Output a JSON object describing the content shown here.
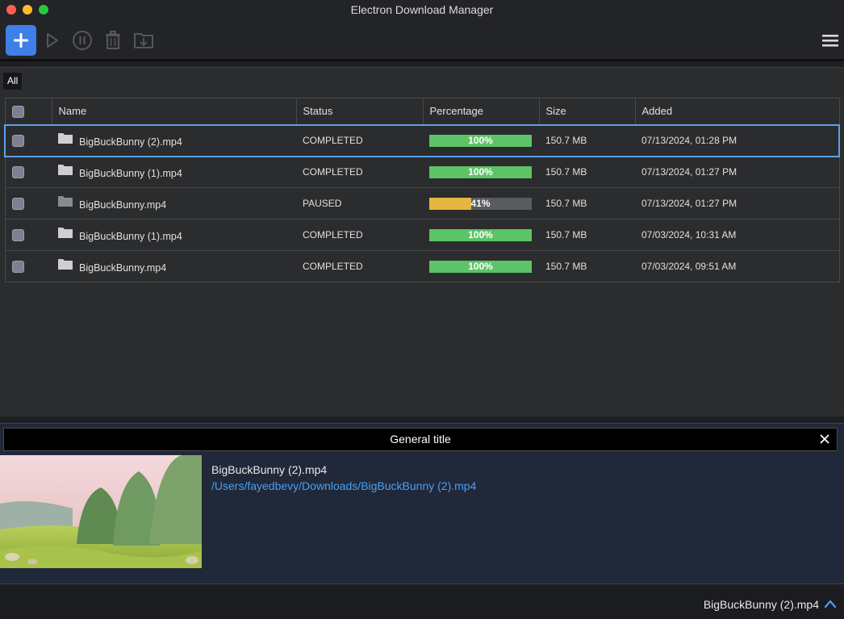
{
  "window": {
    "title": "Electron Download Manager"
  },
  "toolbar": {
    "icons": [
      "plus-icon",
      "play-icon",
      "pause-icon",
      "trash-icon",
      "download-folder-icon",
      "hamburger-menu-icon"
    ]
  },
  "filters": {
    "all_label": "All"
  },
  "table": {
    "headers": {
      "name": "Name",
      "status": "Status",
      "percentage": "Percentage",
      "size": "Size",
      "added": "Added"
    },
    "rows": [
      {
        "name": "BigBuckBunny (2).mp4",
        "status": "COMPLETED",
        "percent_label": "100%",
        "percent": 100,
        "size": "150.7 MB",
        "added": "07/13/2024, 01:28 PM",
        "selected": true
      },
      {
        "name": "BigBuckBunny (1).mp4",
        "status": "COMPLETED",
        "percent_label": "100%",
        "percent": 100,
        "size": "150.7 MB",
        "added": "07/13/2024, 01:27 PM",
        "selected": false
      },
      {
        "name": "BigBuckBunny.mp4",
        "status": "PAUSED",
        "percent_label": "41%",
        "percent": 41,
        "size": "150.7 MB",
        "added": "07/13/2024, 01:27 PM",
        "selected": false
      },
      {
        "name": "BigBuckBunny (1).mp4",
        "status": "COMPLETED",
        "percent_label": "100%",
        "percent": 100,
        "size": "150.7 MB",
        "added": "07/03/2024, 10:31 AM",
        "selected": false
      },
      {
        "name": "BigBuckBunny.mp4",
        "status": "COMPLETED",
        "percent_label": "100%",
        "percent": 100,
        "size": "150.7 MB",
        "added": "07/03/2024, 09:51 AM",
        "selected": false
      }
    ]
  },
  "details": {
    "header_title": "General title",
    "file_name": "BigBuckBunny (2).mp4",
    "file_path": "/Users/fayedbevy/Downloads/BigBuckBunny (2).mp4"
  },
  "statusbar": {
    "file_name": "BigBuckBunny (2).mp4"
  },
  "colors": {
    "accent": "#3f7fe8",
    "completed": "#5cc466",
    "paused": "#e5b740",
    "link": "#4a9ff5",
    "selection": "#5aa2e8"
  }
}
